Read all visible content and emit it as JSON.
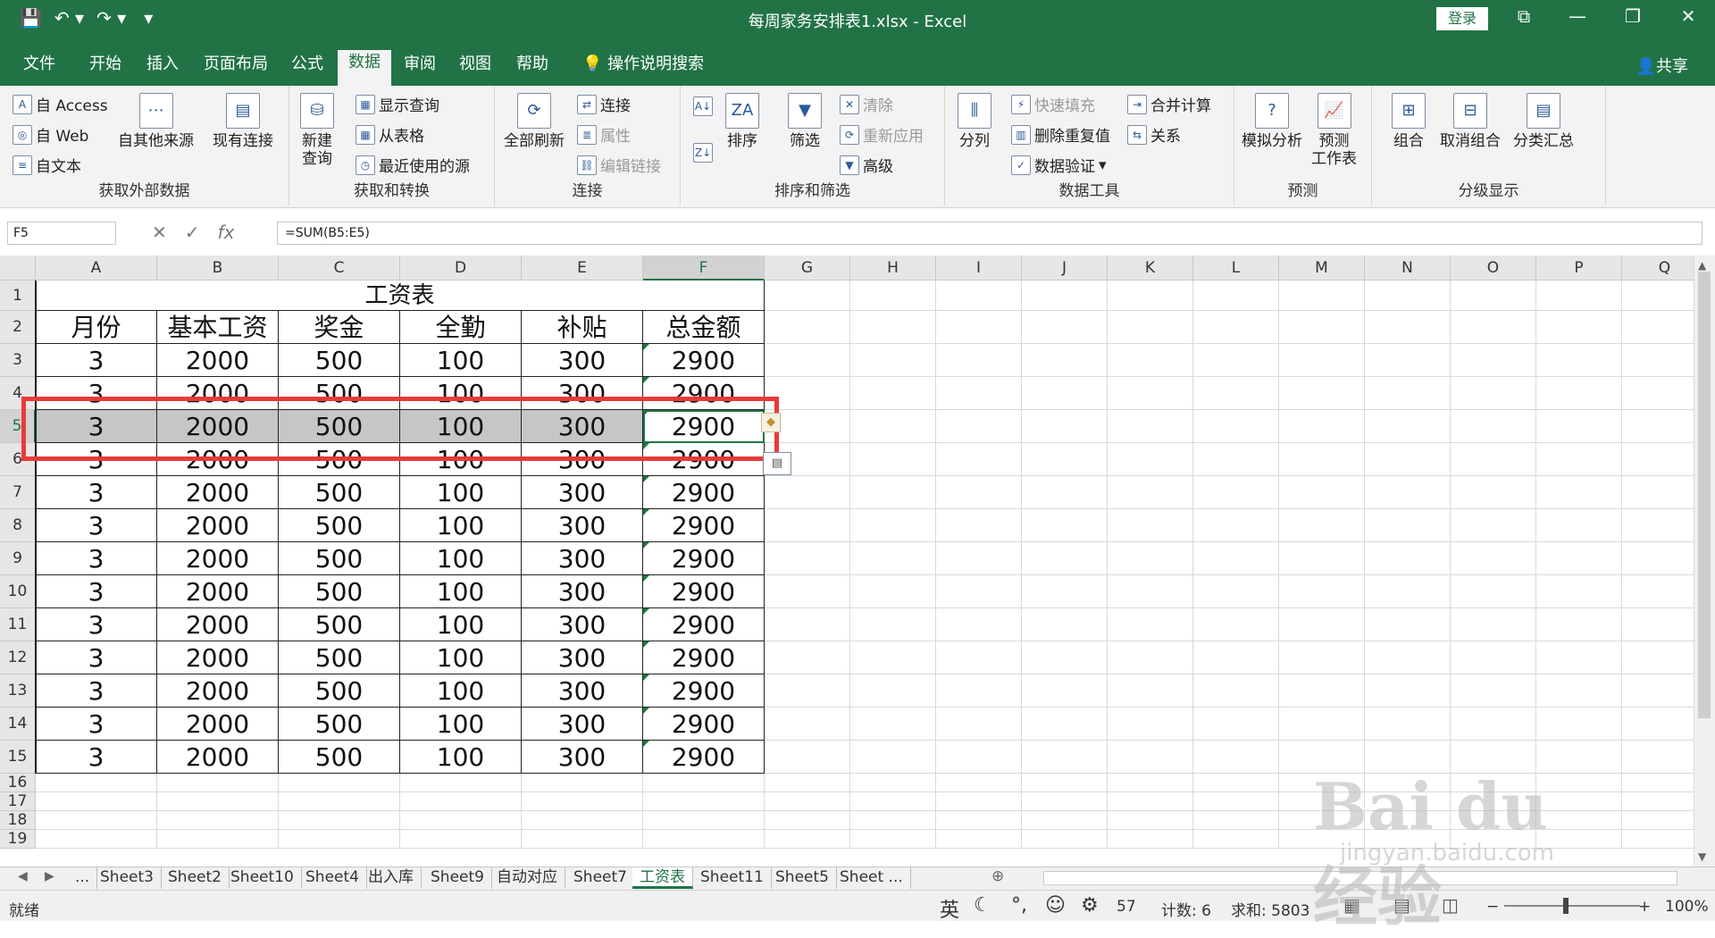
{
  "window": {
    "title": "每周家务安排表1.xlsx  -  Excel",
    "login_label": "登录",
    "minimize": "—",
    "restore": "❐",
    "close": "✕",
    "ribbon_display": "⧉"
  },
  "qat": {
    "save": "💾",
    "undo": "↶ ▾",
    "redo": "↷ ▾",
    "customize": "▾"
  },
  "tabs": [
    "文件",
    "开始",
    "插入",
    "页面布局",
    "公式",
    "数据",
    "审阅",
    "视图",
    "帮助",
    "操作说明搜索"
  ],
  "active_tab": "数据",
  "share_label": "共享",
  "ribbon": {
    "get_external": {
      "label": "获取外部数据",
      "access": "自 Access",
      "web": "自 Web",
      "text": "自文本",
      "other": "自其他来源",
      "existing": "现有连接"
    },
    "get_transform": {
      "label": "获取和转换",
      "new_query": "新建\n查询",
      "show_queries": "显示查询",
      "from_table": "从表格",
      "recent": "最近使用的源"
    },
    "connections": {
      "label": "连接",
      "refresh_all": "全部刷新",
      "connections": "连接",
      "properties": "属性",
      "edit_links": "编辑链接"
    },
    "sort_filter": {
      "label": "排序和筛选",
      "sort": "排序",
      "filter": "筛选",
      "clear": "清除",
      "reapply": "重新应用",
      "advanced": "高级"
    },
    "data_tools": {
      "label": "数据工具",
      "text_to_cols": "分列",
      "flash_fill": "快速填充",
      "remove_dup": "删除重复值",
      "validation": "数据验证",
      "consolidate": "合并计算",
      "relations": "关系"
    },
    "forecast": {
      "label": "预测",
      "what_if": "模拟分析",
      "forecast_sheet": "预测\n工作表"
    },
    "outline": {
      "label": "分级显示",
      "group": "组合",
      "ungroup": "取消组合",
      "subtotal": "分类汇总"
    }
  },
  "formula_bar": {
    "name_box": "F5",
    "formula": "=SUM(B5:E5)",
    "fx": "fx"
  },
  "columns": [
    "A",
    "B",
    "C",
    "D",
    "E",
    "F",
    "G",
    "H",
    "I",
    "J",
    "K",
    "L",
    "M",
    "N",
    "O",
    "P",
    "Q"
  ],
  "rows": [
    "1",
    "2",
    "3",
    "4",
    "5",
    "6",
    "7",
    "8",
    "9",
    "10",
    "11",
    "12",
    "13",
    "14",
    "15",
    "16",
    "17",
    "18",
    "19"
  ],
  "sheet": {
    "title": "工资表",
    "headers": [
      "月份",
      "基本工资",
      "奖金",
      "全勤",
      "补贴",
      "总金额"
    ],
    "data": [
      [
        "3",
        "2000",
        "500",
        "100",
        "300",
        "2900"
      ],
      [
        "3",
        "2000",
        "500",
        "100",
        "300",
        "2900"
      ],
      [
        "3",
        "2000",
        "500",
        "100",
        "300",
        "2900"
      ],
      [
        "3",
        "2000",
        "500",
        "100",
        "300",
        "2900"
      ],
      [
        "3",
        "2000",
        "500",
        "100",
        "300",
        "2900"
      ],
      [
        "3",
        "2000",
        "500",
        "100",
        "300",
        "2900"
      ],
      [
        "3",
        "2000",
        "500",
        "100",
        "300",
        "2900"
      ],
      [
        "3",
        "2000",
        "500",
        "100",
        "300",
        "2900"
      ],
      [
        "3",
        "2000",
        "500",
        "100",
        "300",
        "2900"
      ],
      [
        "3",
        "2000",
        "500",
        "100",
        "300",
        "2900"
      ],
      [
        "3",
        "2000",
        "500",
        "100",
        "300",
        "2900"
      ],
      [
        "3",
        "2000",
        "500",
        "100",
        "300",
        "2900"
      ],
      [
        "3",
        "2000",
        "500",
        "100",
        "300",
        "2900"
      ]
    ]
  },
  "sheet_tabs": [
    "...",
    "Sheet3",
    "Sheet2",
    "Sheet10",
    "Sheet4",
    "出入库",
    "Sheet9",
    "自动对应",
    "Sheet7",
    "工资表",
    "Sheet11",
    "Sheet5",
    "Sheet ..."
  ],
  "active_sheet": "工资表",
  "status": {
    "ready": "就绪",
    "ime": "英",
    "page_hint": "57",
    "count": "计数: 6",
    "sum": "求和: 5803",
    "zoom": "100%"
  },
  "watermark": {
    "big": "Bai du 经验",
    "small": "jingyan.baidu.com"
  },
  "colors": {
    "excel_green": "#217346",
    "highlight_red": "#e83a3a",
    "selection_gray": "#c6c6c6"
  }
}
